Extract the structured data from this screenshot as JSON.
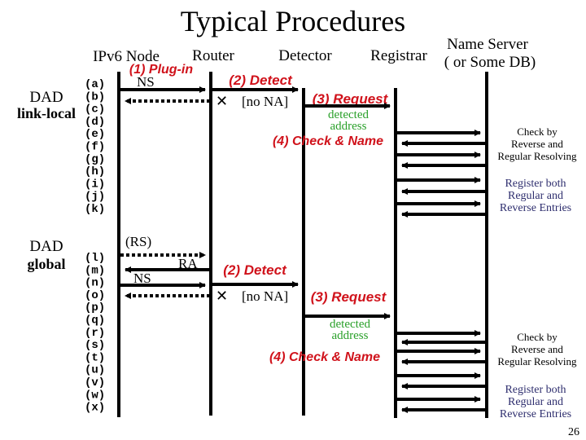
{
  "title": "Typical Procedures",
  "page_number": "26",
  "colors": {
    "line": "#000000",
    "step": "#d0121b",
    "detected": "#2aa02a",
    "note_dark": "#000000",
    "note_blue": "#2e2e6e"
  },
  "actors": [
    {
      "id": "node",
      "label": "IPv6 Node"
    },
    {
      "id": "router",
      "label": "Router"
    },
    {
      "id": "detector",
      "label": "Detector"
    },
    {
      "id": "registrar",
      "label": "Registrar"
    },
    {
      "id": "nameserver",
      "label": "Name Server",
      "label2": "( or Some DB)"
    }
  ],
  "phases": [
    {
      "name": "link-local",
      "label_line1": "DAD",
      "label_line2": "link-local",
      "steps": [
        "(a)",
        "(b)",
        "(c)",
        "(d)",
        "(e)",
        "(f)",
        "(g)",
        "(h)",
        "(i)",
        "(j)",
        "(k)"
      ],
      "step1": "(1) Plug-in",
      "messages": [
        {
          "from": "node",
          "to": "router",
          "style": "solid",
          "label": "NS",
          "row": 0
        },
        {
          "from": "router",
          "to": "node",
          "style": "dotted",
          "label": "",
          "row": 1,
          "lost": true
        }
      ],
      "detect_label": "(2) Detect",
      "no_na": "[no NA]",
      "request_label": "(3) Request",
      "detected_line1": "detected",
      "detected_line2": "address",
      "check_label": "(4) Check & Name",
      "note_check": [
        "Check by",
        "Reverse and",
        "Regular Resolving"
      ],
      "note_register": [
        "Register both",
        "Regular and",
        "Reverse Entries"
      ]
    },
    {
      "name": "global",
      "label_line1": "DAD",
      "label_line2": "global",
      "steps": [
        "(l)",
        "(m)",
        "(n)",
        "(o)",
        "(p)",
        "(q)",
        "(r)",
        "(s)",
        "(t)",
        "(u)",
        "(v)",
        "(w)",
        "(x)"
      ],
      "messages": [
        {
          "from": "node",
          "to": "router",
          "style": "dotted",
          "label": "(RS)",
          "row": 0
        },
        {
          "from": "router",
          "to": "node",
          "style": "solid",
          "label": "RA",
          "row": 1
        },
        {
          "from": "node",
          "to": "router",
          "style": "solid",
          "label": "NS",
          "row": 2
        },
        {
          "from": "router",
          "to": "node",
          "style": "dotted",
          "label": "",
          "row": 3,
          "lost": true
        }
      ],
      "detect_label": "(2) Detect",
      "no_na": "[no NA]",
      "request_label": "(3) Request",
      "detected_line1": "detected",
      "detected_line2": "address",
      "check_label": "(4) Check & Name",
      "note_check": [
        "Check by",
        "Reverse and",
        "Regular Resolving"
      ],
      "note_register": [
        "Register both",
        "Regular and",
        "Reverse Entries"
      ]
    }
  ]
}
